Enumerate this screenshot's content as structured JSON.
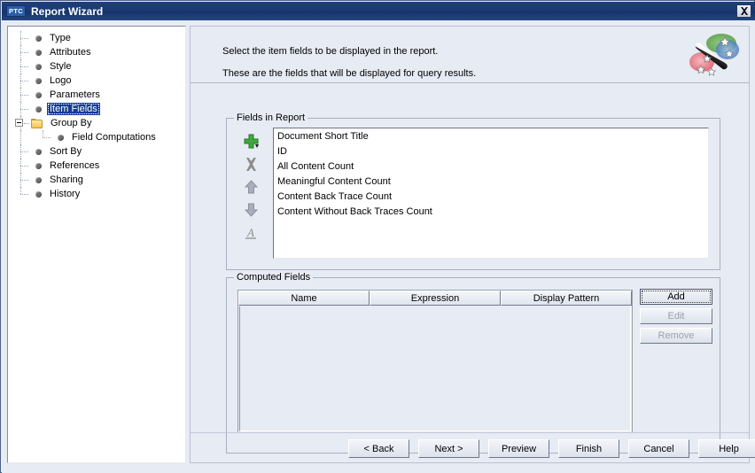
{
  "window": {
    "title": "Report Wizard",
    "logo_text": "PTC",
    "close_icon": "close-icon"
  },
  "tree": {
    "items": [
      {
        "label": "Type",
        "icon": "bullet-icon",
        "level": 1,
        "selected": false
      },
      {
        "label": "Attributes",
        "icon": "bullet-icon",
        "level": 1,
        "selected": false
      },
      {
        "label": "Style",
        "icon": "bullet-icon",
        "level": 1,
        "selected": false
      },
      {
        "label": "Logo",
        "icon": "bullet-icon",
        "level": 1,
        "selected": false
      },
      {
        "label": "Parameters",
        "icon": "bullet-icon",
        "level": 1,
        "selected": false
      },
      {
        "label": "Item Fields",
        "icon": "bullet-icon",
        "level": 1,
        "selected": true
      },
      {
        "label": "Group By",
        "icon": "folder-icon",
        "level": 1,
        "selected": false,
        "expanded": true
      },
      {
        "label": "Field Computations",
        "icon": "bullet-icon",
        "level": 2,
        "selected": false
      },
      {
        "label": "Sort By",
        "icon": "bullet-icon",
        "level": 1,
        "selected": false
      },
      {
        "label": "References",
        "icon": "bullet-icon",
        "level": 1,
        "selected": false
      },
      {
        "label": "Sharing",
        "icon": "bullet-icon",
        "level": 1,
        "selected": false
      },
      {
        "label": "History",
        "icon": "bullet-icon",
        "level": 1,
        "selected": false
      }
    ]
  },
  "header": {
    "instruction_1": "Select the item fields to be displayed in the report.",
    "instruction_2": "These are the fields that will be displayed for query results.",
    "wizard_icon": "magic-wand-icon"
  },
  "fields_in_report": {
    "title": "Fields in Report",
    "toolbar": [
      {
        "name": "add-field-icon",
        "glyph": "plus",
        "enabled": true
      },
      {
        "name": "remove-field-icon",
        "glyph": "x",
        "enabled": false
      },
      {
        "name": "move-up-icon",
        "glyph": "arrow-up",
        "enabled": false
      },
      {
        "name": "move-down-icon",
        "glyph": "arrow-down",
        "enabled": false
      },
      {
        "name": "rename-field-icon",
        "glyph": "a-rename",
        "enabled": false
      }
    ],
    "items": [
      "Document Short Title",
      "ID",
      "All Content Count",
      "Meaningful Content Count",
      "Content Back Trace Count",
      "Content Without Back Traces Count"
    ]
  },
  "computed_fields": {
    "title": "Computed Fields",
    "columns": [
      "Name",
      "Expression",
      "Display Pattern"
    ],
    "rows": [],
    "buttons": [
      {
        "label": "Add",
        "enabled": true,
        "focused": true
      },
      {
        "label": "Edit",
        "enabled": false,
        "focused": false
      },
      {
        "label": "Remove",
        "enabled": false,
        "focused": false
      }
    ]
  },
  "footer": {
    "buttons": [
      "< Back",
      "Next >",
      "Preview",
      "Finish",
      "Cancel",
      "Help"
    ]
  },
  "colors": {
    "titlebar": "#1b3a72",
    "panel_bg": "#e7ebf4",
    "selection": "#15399c",
    "accent_green": "#3fa93f",
    "folder_yellow": "#f3c34f"
  }
}
